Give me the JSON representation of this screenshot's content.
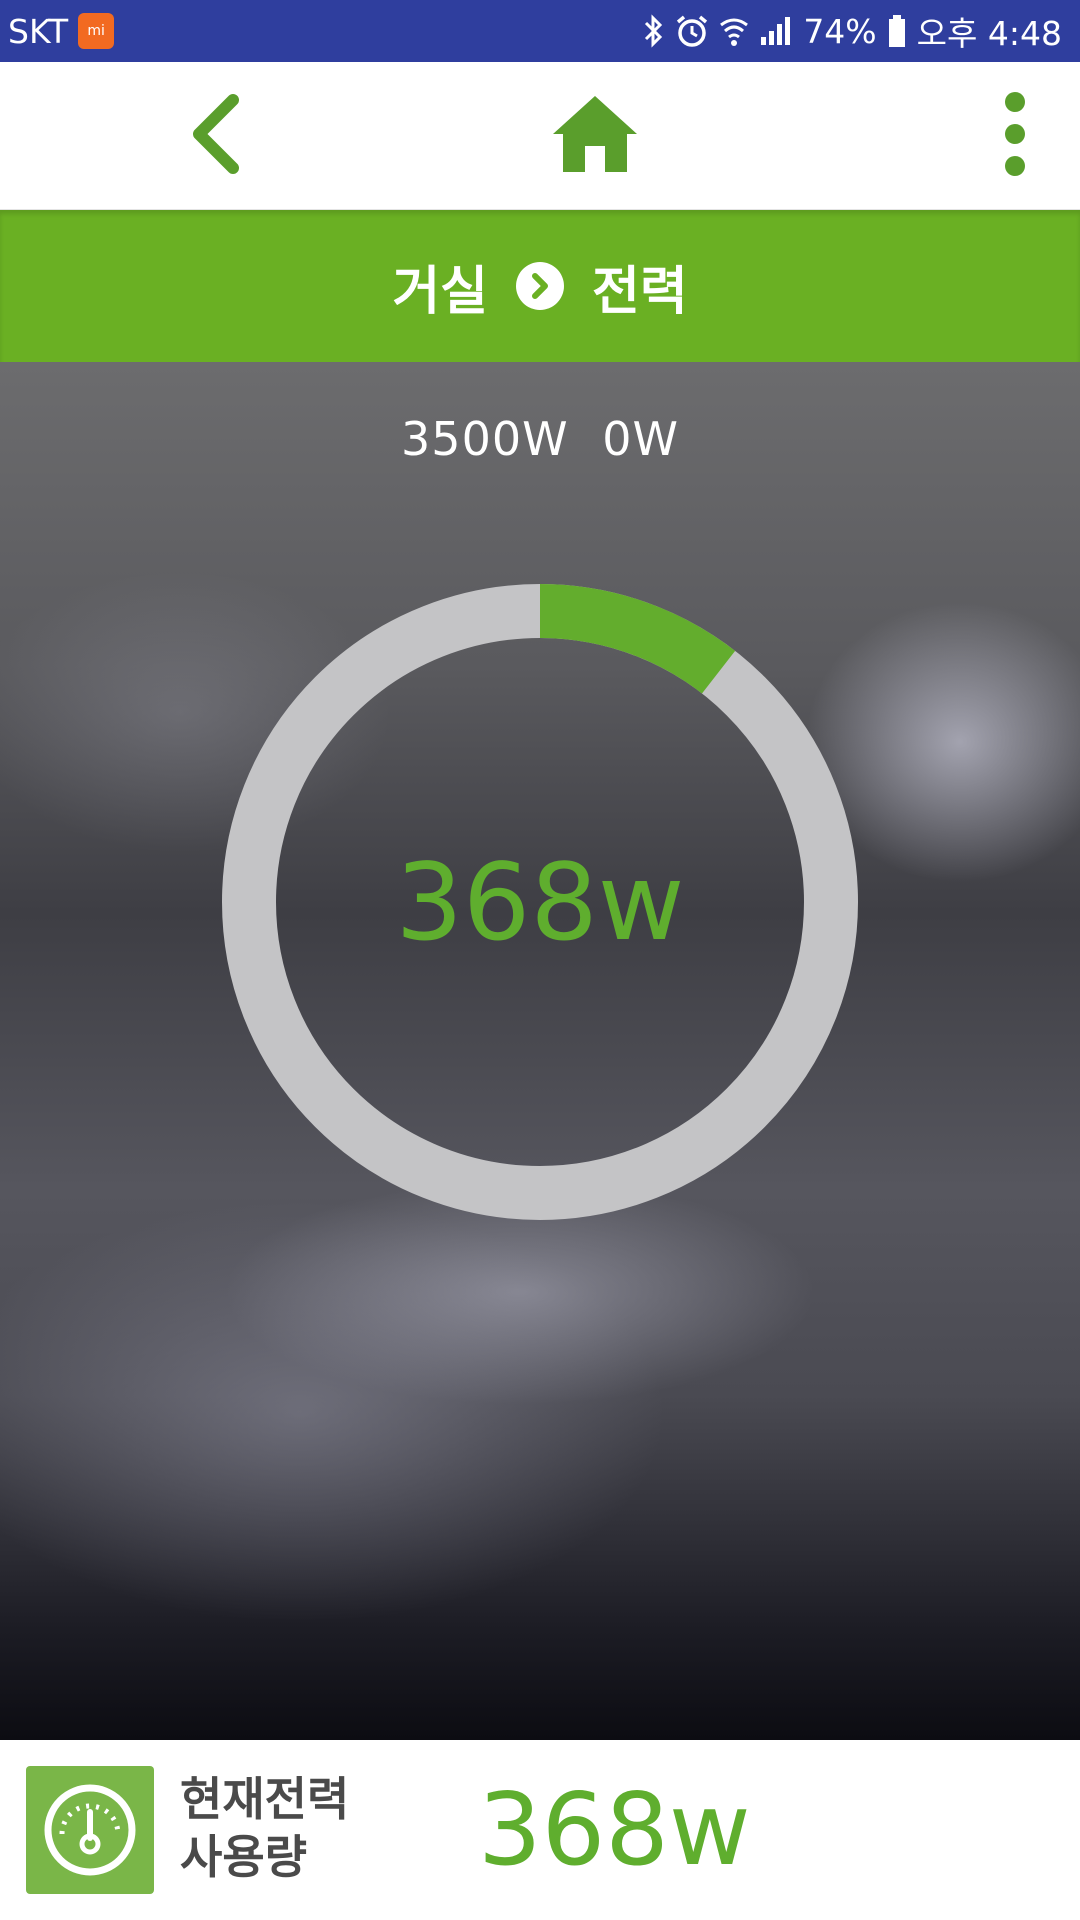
{
  "status_bar": {
    "carrier": "SKT",
    "battery": "74%",
    "time": "오후 4:48",
    "icons": [
      "bluetooth-icon",
      "alarm-icon",
      "wifi-icon",
      "signal-icon",
      "battery-icon"
    ]
  },
  "toolbar": {
    "back_icon": "back-chevron-icon",
    "home_icon": "home-icon",
    "more_icon": "more-vert-icon"
  },
  "breadcrumb": {
    "room": "거실",
    "category": "전력"
  },
  "gauge": {
    "range_text": "3500W  0W",
    "max_w": 3500,
    "current_w": 368,
    "value_text": "368w",
    "fill_color": "#63ad2d",
    "track_color": "#c4c4c6"
  },
  "summary": {
    "icon": "power-meter-icon",
    "label": "현재전력\n사용량",
    "value_text": "368w"
  },
  "colors": {
    "accent": "#6ab023",
    "status_bar": "#2f3e9e"
  }
}
